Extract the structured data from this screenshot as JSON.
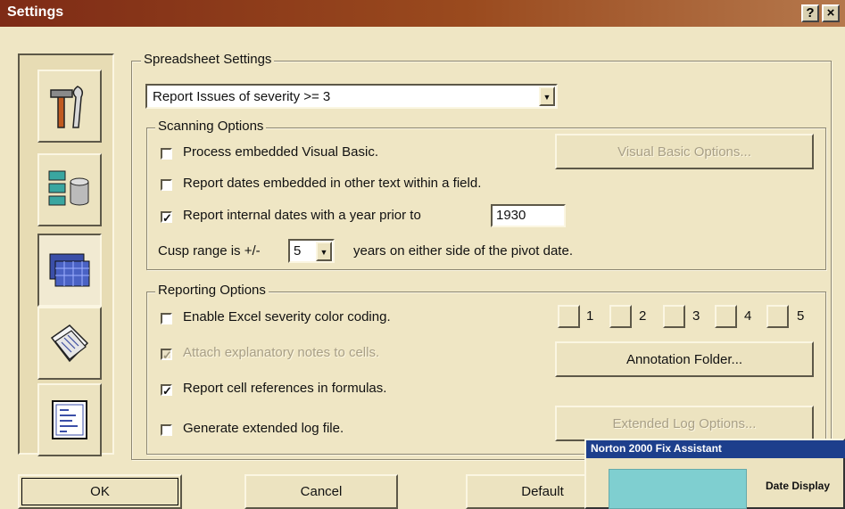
{
  "window": {
    "title": "Settings",
    "help": "?",
    "close": "×"
  },
  "spreadsheet": {
    "group_label": "Spreadsheet Settings",
    "severity_select": "Report Issues of severity >= 3"
  },
  "scanning": {
    "group_label": "Scanning Options",
    "process_vb": {
      "label": "Process embedded Visual Basic.",
      "checked": false
    },
    "vb_options_button": "Visual Basic Options...",
    "report_embedded": {
      "label": "Report dates embedded in other text within a field.",
      "checked": false
    },
    "report_internal": {
      "label": "Report internal dates with a year prior to",
      "checked": true,
      "mark": "✓"
    },
    "year_value": "1930",
    "cusp_prefix": "Cusp range is +/-",
    "cusp_value": "5",
    "cusp_suffix": "years on either side of the pivot date."
  },
  "reporting": {
    "group_label": "Reporting Options",
    "excel_color": {
      "label": "Enable Excel severity color coding.",
      "checked": false
    },
    "severity_levels": [
      "1",
      "2",
      "3",
      "4",
      "5"
    ],
    "attach_notes": {
      "label": "Attach explanatory notes to cells.",
      "checked": true,
      "mark": "✓"
    },
    "annotation_button": "Annotation Folder...",
    "cell_refs": {
      "label": "Report cell references in formulas.",
      "checked": true,
      "mark": "✓"
    },
    "extended_log": {
      "label": "Generate extended log file.",
      "checked": false
    },
    "extended_button": "Extended Log Options..."
  },
  "buttons": {
    "ok": "OK",
    "cancel": "Cancel",
    "default": "Default"
  },
  "popup": {
    "title": "Norton 2000 Fix Assistant",
    "label": "Date Display"
  },
  "sidebar_icons": [
    "tools-icon",
    "database-icon",
    "spreadsheet-icon",
    "documents-icon",
    "report-icon"
  ]
}
